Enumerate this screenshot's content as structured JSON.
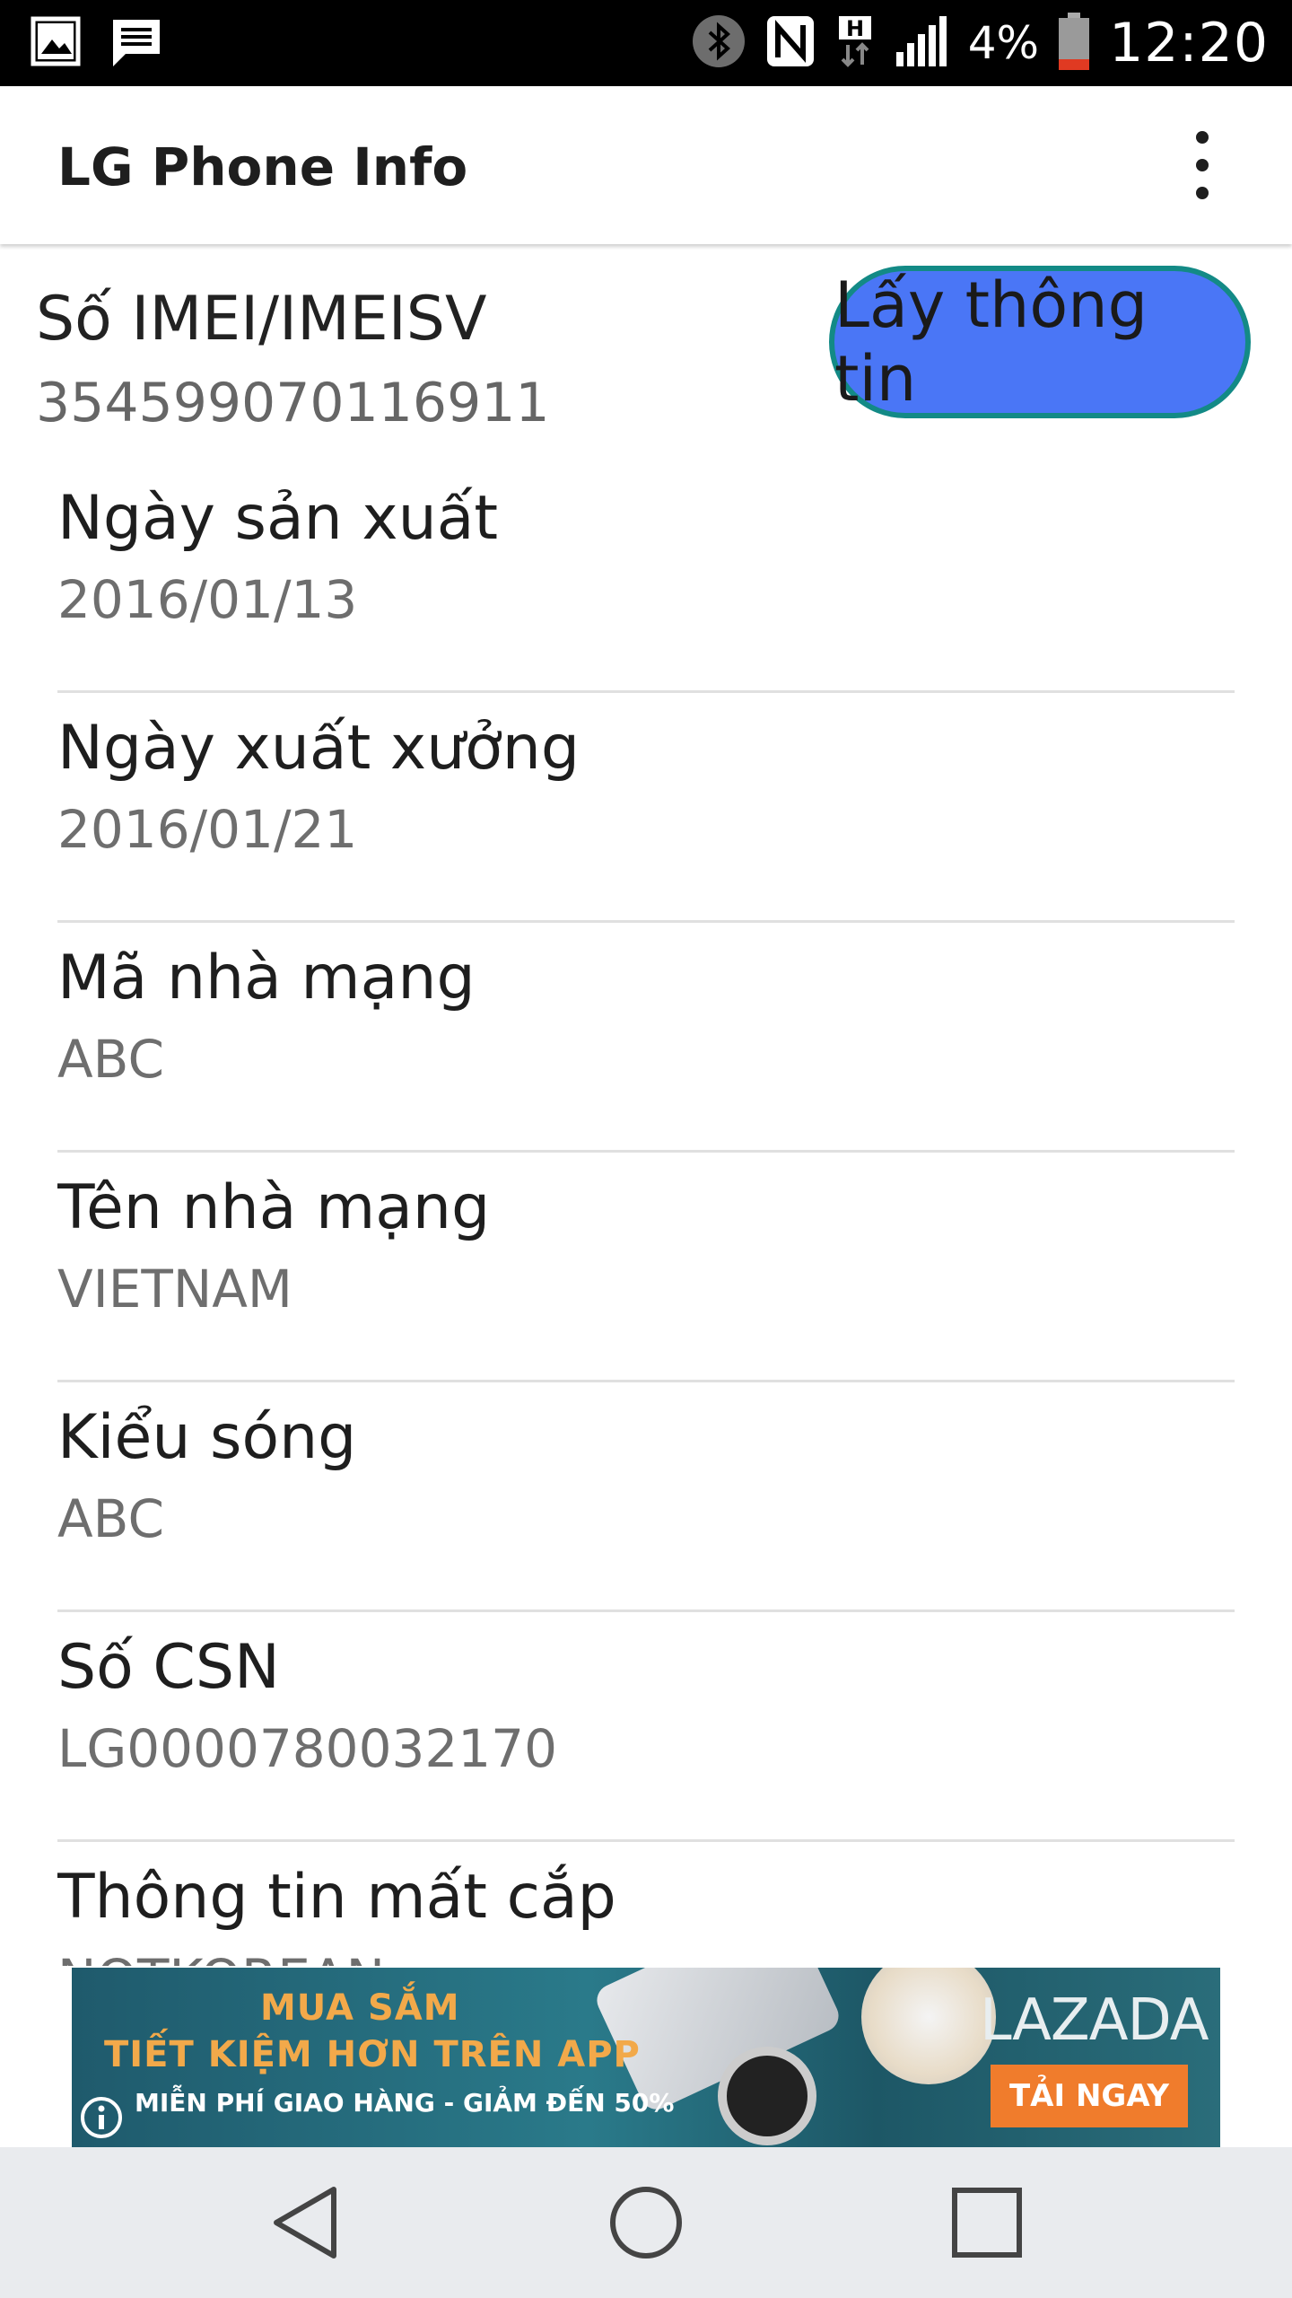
{
  "status_bar": {
    "battery_percent": "4%",
    "time": "12:20",
    "icons": [
      "image-icon",
      "message-icon",
      "bluetooth-icon",
      "nfc-icon",
      "h-network-icon",
      "signal-icon",
      "battery-icon"
    ]
  },
  "app_bar": {
    "title": "LG Phone Info",
    "overflow_icon": "more-vert-icon"
  },
  "imei": {
    "label": "Số IMEI/IMEISV",
    "value": "354599070116911"
  },
  "fetch_button": {
    "label": "Lấy thông tin",
    "background": "#4a76f6",
    "border": "#138a86"
  },
  "info_items": [
    {
      "label": "Ngày sản xuất",
      "value": "2016/01/13"
    },
    {
      "label": "Ngày xuất xưởng",
      "value": "2016/01/21"
    },
    {
      "label": "Mã nhà mạng",
      "value": "ABC"
    },
    {
      "label": "Tên nhà mạng",
      "value": "VIETNAM"
    },
    {
      "label": "Kiểu sóng",
      "value": "ABC"
    },
    {
      "label": "Số CSN",
      "value": "LG0000780032170"
    },
    {
      "label": "Thông tin mất cắp",
      "value": "NOTKOREAN"
    }
  ],
  "ad": {
    "line1": "MUA SẮM",
    "line2": "TIẾT KIỆM HƠN TRÊN APP",
    "line3": "MIỄN PHÍ GIAO HÀNG - GIẢM ĐẾN 50%",
    "brand": "LAZADA",
    "cta": "TẢI NGAY",
    "info_icon": "info-icon"
  },
  "nav_bar": {
    "icons": [
      "back-icon",
      "home-icon",
      "recents-icon"
    ]
  }
}
